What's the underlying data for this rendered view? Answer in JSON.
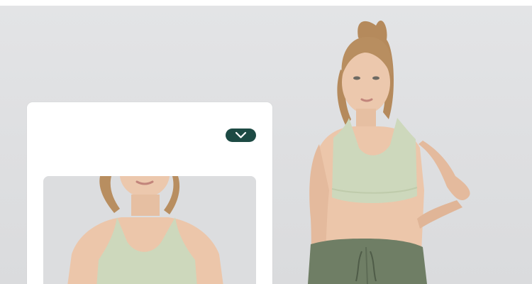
{
  "page": {
    "background_color": "#dedfe1",
    "accent_color": "#1d4a44"
  },
  "hero": {
    "image": "model-wearing-sage-green-sports-bra-and-olive-shorts"
  },
  "card": {
    "toggle_icon": "chevron-down-icon",
    "thumbnail": "close-up-sage-green-sports-bra"
  },
  "colors": {
    "bra": "#cdd8bc",
    "shorts": "#6f7e65",
    "hair": "#b58a5c",
    "skin": "#ebc6ab"
  }
}
